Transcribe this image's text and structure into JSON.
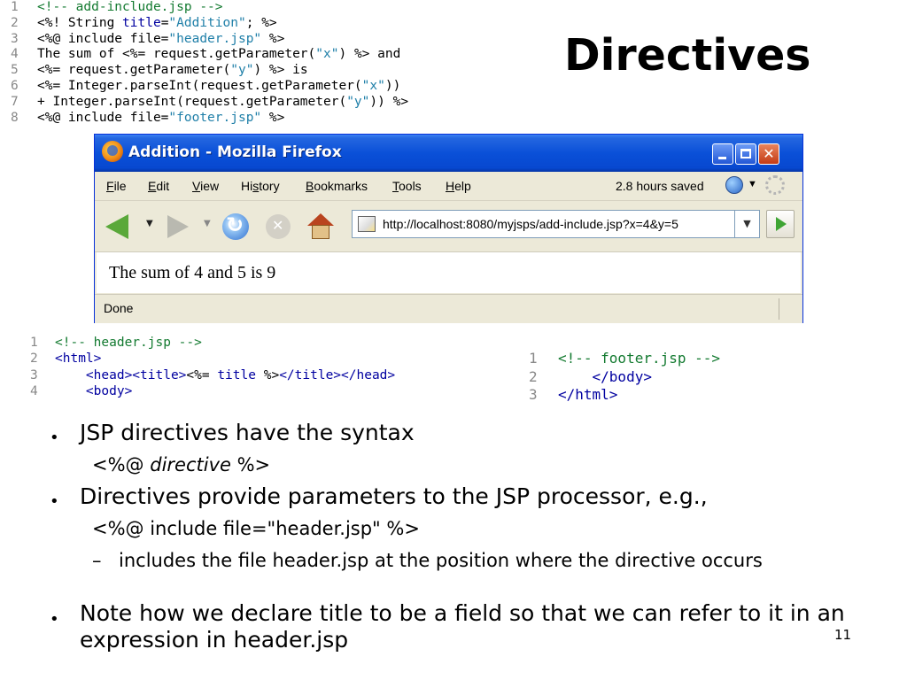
{
  "slide": {
    "title": "Directives",
    "page_number": "11"
  },
  "code_main": [
    {
      "n": "1",
      "parts": [
        {
          "t": "<!-- add-include.jsp -->",
          "c": "cm"
        }
      ]
    },
    {
      "n": "2",
      "parts": [
        {
          "t": "<%! String ",
          "c": ""
        },
        {
          "t": "title",
          "c": "kw"
        },
        {
          "t": "=",
          "c": ""
        },
        {
          "t": "\"Addition\"",
          "c": "str"
        },
        {
          "t": "; %>",
          "c": ""
        }
      ]
    },
    {
      "n": "3",
      "parts": [
        {
          "t": "<%@ include file=",
          "c": ""
        },
        {
          "t": "\"header.jsp\"",
          "c": "str"
        },
        {
          "t": " %>",
          "c": ""
        }
      ]
    },
    {
      "n": "4",
      "parts": [
        {
          "t": "The sum of <%= request.getParameter(",
          "c": ""
        },
        {
          "t": "\"x\"",
          "c": "str"
        },
        {
          "t": ") %> and",
          "c": ""
        }
      ]
    },
    {
      "n": "5",
      "parts": [
        {
          "t": "<%= request.getParameter(",
          "c": ""
        },
        {
          "t": "\"y\"",
          "c": "str"
        },
        {
          "t": ") %> is",
          "c": ""
        }
      ]
    },
    {
      "n": "6",
      "parts": [
        {
          "t": "<%= Integer.parseInt(request.getParameter(",
          "c": ""
        },
        {
          "t": "\"x\"",
          "c": "str"
        },
        {
          "t": "))",
          "c": ""
        }
      ]
    },
    {
      "n": "7",
      "parts": [
        {
          "t": "+ Integer.parseInt(request.getParameter(",
          "c": ""
        },
        {
          "t": "\"y\"",
          "c": "str"
        },
        {
          "t": ")) %>",
          "c": ""
        }
      ]
    },
    {
      "n": "8",
      "parts": [
        {
          "t": "<%@ include file=",
          "c": ""
        },
        {
          "t": "\"footer.jsp\"",
          "c": "str"
        },
        {
          "t": " %>",
          "c": ""
        }
      ]
    }
  ],
  "code_header": [
    {
      "n": "1",
      "parts": [
        {
          "t": "<!-- header.jsp -->",
          "c": "cm"
        }
      ]
    },
    {
      "n": "2",
      "parts": [
        {
          "t": "<html>",
          "c": "tag"
        }
      ]
    },
    {
      "n": "3",
      "parts": [
        {
          "t": "    <head><title>",
          "c": "tag"
        },
        {
          "t": "<%= ",
          "c": ""
        },
        {
          "t": "title",
          "c": "kw"
        },
        {
          "t": " %>",
          "c": ""
        },
        {
          "t": "</title></head>",
          "c": "tag"
        }
      ]
    },
    {
      "n": "4",
      "parts": [
        {
          "t": "    <body>",
          "c": "tag"
        }
      ]
    }
  ],
  "code_footer": [
    {
      "n": "1",
      "parts": [
        {
          "t": "<!-- footer.jsp -->",
          "c": "cm"
        }
      ]
    },
    {
      "n": "2",
      "parts": [
        {
          "t": "    </body>",
          "c": "tag"
        }
      ]
    },
    {
      "n": "3",
      "parts": [
        {
          "t": "</html>",
          "c": "tag"
        }
      ]
    }
  ],
  "browser": {
    "window_title": "Addition - Mozilla Firefox",
    "menu": [
      "File",
      "Edit",
      "View",
      "History",
      "Bookmarks",
      "Tools",
      "Help"
    ],
    "menu_access": [
      "F",
      "E",
      "V",
      "s",
      "B",
      "T",
      "H"
    ],
    "save_status": "2.8 hours saved",
    "url": "http://localhost:8080/myjsps/add-include.jsp?x=4&y=5",
    "page_text": "The sum of 4 and 5 is 9",
    "status": "Done"
  },
  "bullets": {
    "b1": "JSP directives have the syntax",
    "b1_sub_pre": "<%@ ",
    "b1_sub_em": "directive",
    "b1_sub_post": " %>",
    "b2": "Directives provide parameters to the JSP processor, e.g.,",
    "b2_sub": "<%@ include file=\"header.jsp\" %>",
    "b2_dash": "includes the file header.jsp at the position where the directive occurs",
    "b3": "Note how we declare title to be a field so that we can refer to it in an expression in header.jsp"
  },
  "icons": [
    "firefox-logo-icon",
    "minimize-icon",
    "maximize-icon",
    "close-icon",
    "history-icon",
    "throbber-icon",
    "back-icon",
    "forward-icon",
    "reload-icon",
    "stop-icon",
    "home-icon",
    "page-icon",
    "go-icon"
  ]
}
